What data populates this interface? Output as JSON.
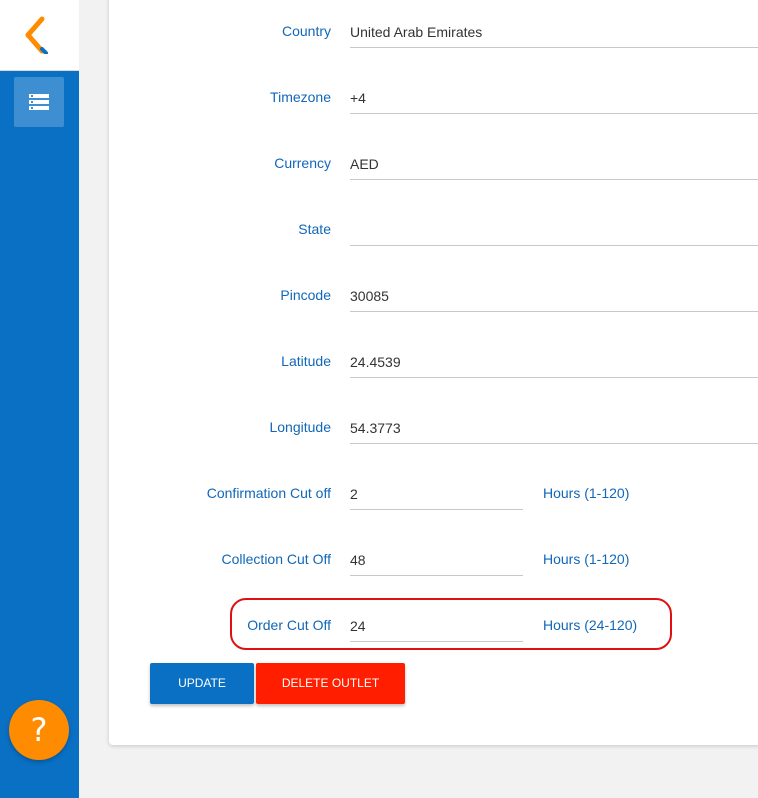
{
  "sidebar": {
    "logo_icon": "brand-logo-icon",
    "menu_icon": "list-icon",
    "help_label": "?"
  },
  "form": {
    "fields": [
      {
        "label": "Country",
        "value": "United Arab Emirates"
      },
      {
        "label": "Timezone",
        "value": "+4"
      },
      {
        "label": "Currency",
        "value": "AED"
      },
      {
        "label": "State",
        "value": ""
      },
      {
        "label": "Pincode",
        "value": "30085"
      },
      {
        "label": "Latitude",
        "value": "24.4539"
      },
      {
        "label": "Longitude",
        "value": "54.3773"
      },
      {
        "label": "Confirmation Cut off",
        "value": "2",
        "unit": "Hours (1-120)"
      },
      {
        "label": "Collection Cut Off",
        "value": "48",
        "unit": "Hours (1-120)"
      },
      {
        "label": "Order Cut Off",
        "value": "24",
        "unit": "Hours (24-120)"
      }
    ],
    "update_label": "UPDATE",
    "delete_label": "DELETE OUTLET"
  },
  "colors": {
    "sidebar": "#0a70c4",
    "label": "#1167b8",
    "highlight": "#e01010",
    "delete": "#ff1e00",
    "help": "#ff8c00"
  }
}
